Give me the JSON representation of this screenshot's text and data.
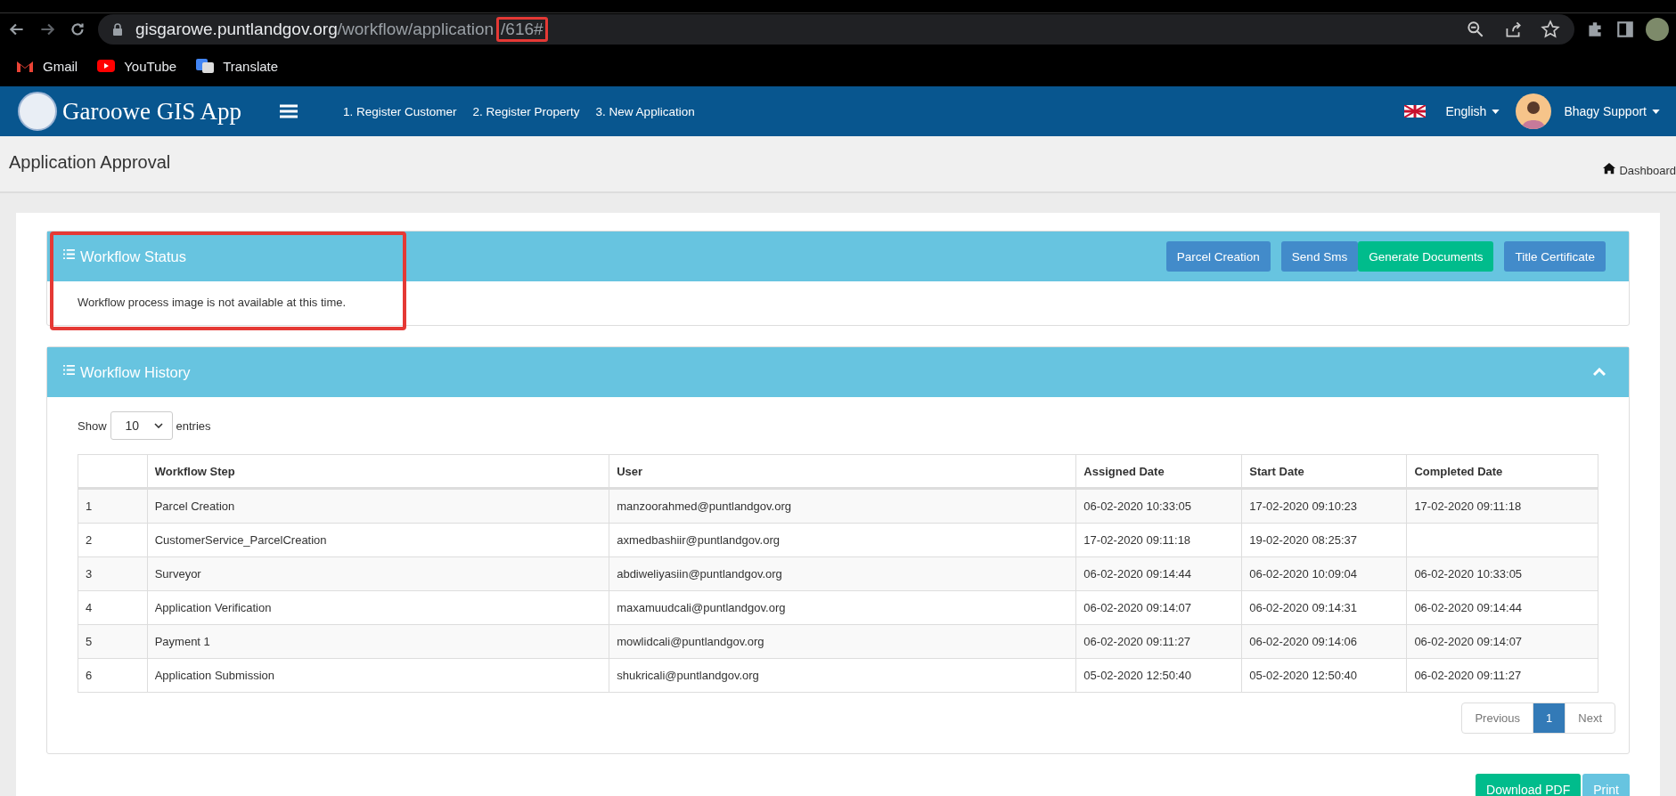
{
  "browser": {
    "url": {
      "host": "gisgarowe.puntlandgov.org",
      "path": "/workflow/application",
      "id": "/616#"
    },
    "bookmarks": [
      {
        "label": "Gmail",
        "kind": "mail"
      },
      {
        "label": "YouTube",
        "kind": "video"
      },
      {
        "label": "Translate",
        "kind": "translate"
      }
    ]
  },
  "navbar": {
    "brand": "Garoowe GIS App",
    "links": [
      "1. Register Customer",
      "2. Register Property",
      "3. New Application"
    ],
    "language": "English",
    "user": "Bhagy Support"
  },
  "page_header": {
    "title": "Application Approval",
    "breadcrumb": "Dashboard"
  },
  "workflow_status": {
    "title": "Workflow Status",
    "buttons": [
      {
        "label": "Parcel Creation",
        "kind": "primary"
      },
      {
        "label": "Send Sms",
        "kind": "primary"
      },
      {
        "label": "Generate Documents",
        "kind": "success"
      },
      {
        "label": "Title Certificate",
        "kind": "primary"
      }
    ],
    "message": "Workflow process image is not available at this time."
  },
  "workflow_history": {
    "title": "Workflow History",
    "show_label": "Show",
    "entries_value": "10",
    "entries_label": "entries",
    "columns": [
      "",
      "Workflow Step",
      "User",
      "Assigned Date",
      "Start Date",
      "Completed Date"
    ],
    "rows": [
      [
        "1",
        "Parcel Creation",
        "manzoorahmed@puntlandgov.org",
        "06-02-2020 10:33:05",
        "17-02-2020 09:10:23",
        "17-02-2020 09:11:18"
      ],
      [
        "2",
        "CustomerService_ParcelCreation",
        "axmedbashiir@puntlandgov.org",
        "17-02-2020 09:11:18",
        "19-02-2020 08:25:37",
        ""
      ],
      [
        "3",
        "Surveyor",
        "abdiweliyasiin@puntlandgov.org",
        "06-02-2020 09:14:44",
        "06-02-2020 10:09:04",
        "06-02-2020 10:33:05"
      ],
      [
        "4",
        "Application Verification",
        "maxamuudcali@puntlandgov.org",
        "06-02-2020 09:14:07",
        "06-02-2020 09:14:31",
        "06-02-2020 09:14:44"
      ],
      [
        "5",
        "Payment 1",
        "mowlidcali@puntlandgov.org",
        "06-02-2020 09:11:27",
        "06-02-2020 09:14:06",
        "06-02-2020 09:14:07"
      ],
      [
        "6",
        "Application Submission",
        "shukricali@puntlandgov.org",
        "05-02-2020 12:50:40",
        "05-02-2020 12:50:40",
        "06-02-2020 09:11:27"
      ]
    ],
    "pagination": [
      {
        "label": "Previous",
        "selected": false
      },
      {
        "label": "1",
        "selected": true
      },
      {
        "label": "Next",
        "selected": false
      }
    ]
  },
  "footer_buttons": [
    {
      "label": "Download PDF",
      "kind": "success"
    },
    {
      "label": "Print",
      "kind": "info"
    }
  ]
}
